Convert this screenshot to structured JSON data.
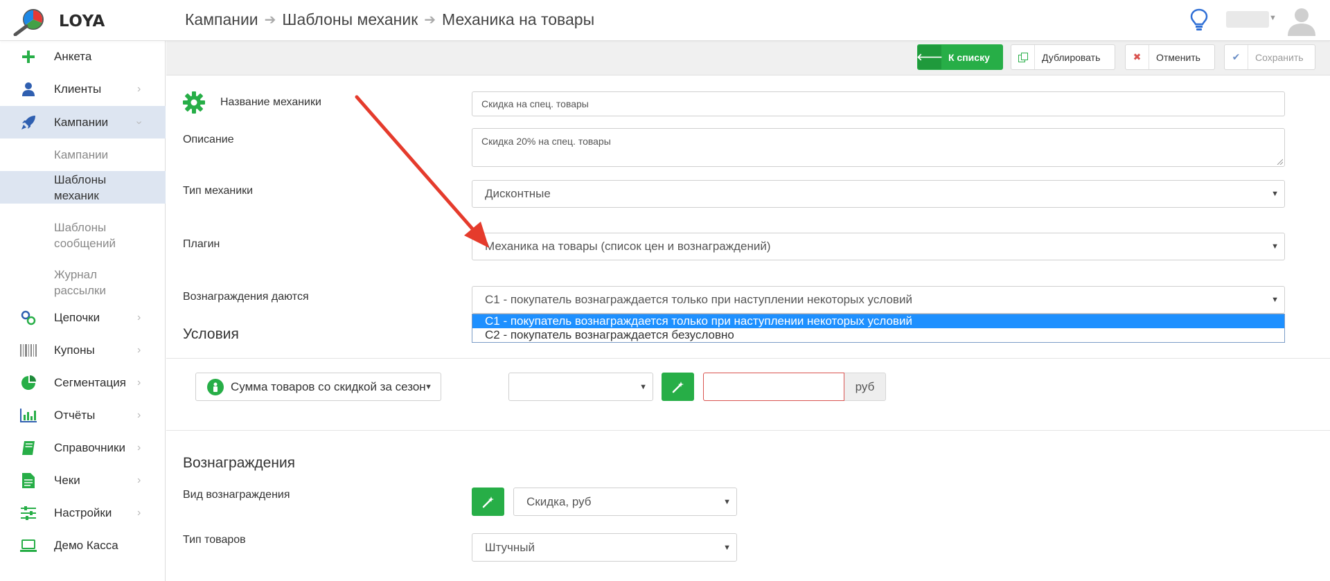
{
  "app": {
    "name": "LOYA"
  },
  "breadcrumb": [
    "Кампании",
    "Шаблоны механик",
    "Механика на товары"
  ],
  "sidebar": {
    "items": [
      {
        "label": "Анкета",
        "icon": "plus-icon"
      },
      {
        "label": "Клиенты",
        "icon": "user-icon"
      },
      {
        "label": "Кампании",
        "icon": "rocket-icon"
      },
      {
        "label": "Цепочки",
        "icon": "chain-icon"
      },
      {
        "label": "Купоны",
        "icon": "barcode-icon"
      },
      {
        "label": "Сегментация",
        "icon": "pie-chart-icon"
      },
      {
        "label": "Отчёты",
        "icon": "bar-chart-icon"
      },
      {
        "label": "Справочники",
        "icon": "book-icon"
      },
      {
        "label": "Чеки",
        "icon": "document-icon"
      },
      {
        "label": "Настройки",
        "icon": "sliders-icon"
      },
      {
        "label": "Демо Касса",
        "icon": "laptop-icon"
      }
    ],
    "campaign_subitems": [
      "Кампании",
      "Шаблоны механик",
      "Шаблоны сообщений",
      "Журнал рассылки"
    ]
  },
  "toolbar": {
    "back_label": "К списку",
    "duplicate_label": "Дублировать",
    "cancel_label": "Отменить",
    "save_label": "Сохранить"
  },
  "form": {
    "name_label": "Название механики",
    "name_value": "Скидка на спец. товары",
    "description_label": "Описание",
    "description_value": "Скидка 20% на спец. товары",
    "type_label": "Тип механики",
    "type_value": "Дисконтные",
    "plugin_label": "Плагин",
    "plugin_value": "Механика на товары (список цен и вознаграждений)",
    "rewards_given_label": "Вознаграждения даются",
    "rewards_given_value": "С1 - покупатель вознаграждается только при наступлении некоторых условий",
    "rewards_given_options": [
      "С1 - покупатель вознаграждается только при наступлении некоторых условий",
      "С2 - покупатель вознаграждается безусловно"
    ]
  },
  "conditions": {
    "title": "Условия",
    "condition_select": "Сумма товаров со скидкой за сезон",
    "operator_select": "",
    "amount_value": "",
    "currency": "руб"
  },
  "rewards": {
    "title": "Вознаграждения",
    "kind_label": "Вид вознаграждения",
    "kind_value": "Скидка, руб",
    "goods_type_label": "Тип товаров",
    "goods_type_value": "Штучный"
  },
  "colors": {
    "accent_green": "#27ae47",
    "selection_blue": "#1e90ff",
    "annotation_arrow": "#e53b2c",
    "active_nav_bg": "#dde5f1"
  }
}
